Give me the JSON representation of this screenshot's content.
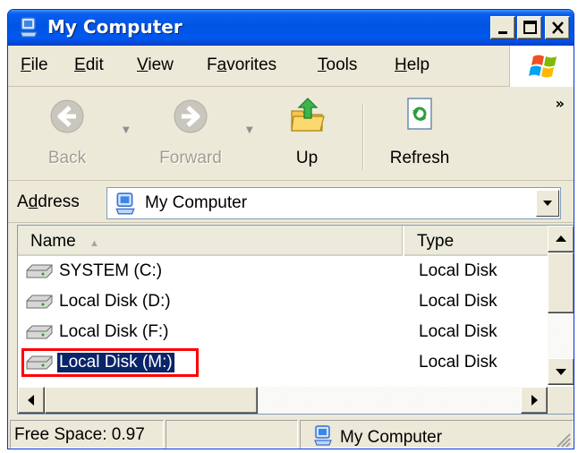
{
  "window": {
    "title": "My Computer"
  },
  "menu": {
    "items": [
      {
        "label": "File",
        "underline": "F",
        "rest": "ile"
      },
      {
        "label": "Edit",
        "underline": "E",
        "rest": "dit"
      },
      {
        "label": "View",
        "underline": "V",
        "rest": "iew"
      },
      {
        "label": "Favorites",
        "pre": "F",
        "underline": "a",
        "rest": "vorites"
      },
      {
        "label": "Tools",
        "underline": "T",
        "rest": "ools"
      },
      {
        "label": "Help",
        "underline": "H",
        "rest": "elp"
      }
    ]
  },
  "toolbar": {
    "back_label": "Back",
    "forward_label": "Forward",
    "up_label": "Up",
    "refresh_label": "Refresh",
    "more": "»"
  },
  "address": {
    "label_pre": "A",
    "label_u": "d",
    "label_rest": "dress",
    "value": "My Computer"
  },
  "list": {
    "columns": [
      {
        "label": "Name",
        "sort": "▲"
      },
      {
        "label": "Type"
      }
    ],
    "rows": [
      {
        "name": "SYSTEM (C:)",
        "type": "Local Disk",
        "selected": false
      },
      {
        "name": "Local Disk (D:)",
        "type": "Local Disk",
        "selected": false
      },
      {
        "name": "Local Disk (F:)",
        "type": "Local Disk",
        "selected": false
      },
      {
        "name": "Local Disk (M:)",
        "type": "Local Disk",
        "selected": true
      }
    ]
  },
  "status": {
    "free_space": "Free Space: 0.97",
    "location": "My Computer"
  },
  "colors": {
    "title_bar": "#0054e3",
    "selection": "#0a246a",
    "highlight_box": "#ff0000"
  }
}
